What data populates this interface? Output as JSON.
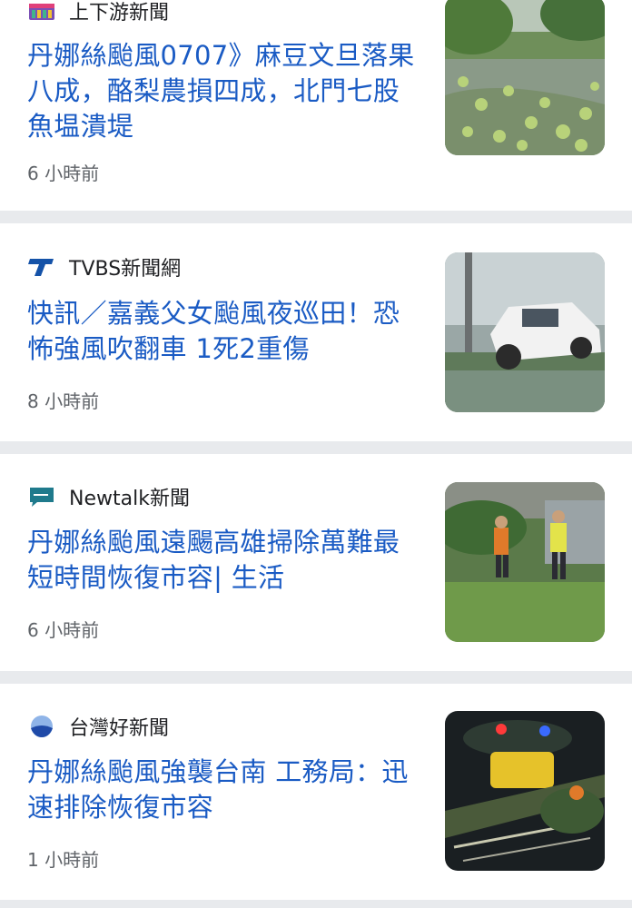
{
  "articles": [
    {
      "source": "上下游新聞",
      "source_icon": "newsmarket-logo-icon",
      "headline": "丹娜絲颱風0707》麻豆文旦落果八成，酪梨農損四成，北門七股魚塭潰堤",
      "time": "6 小時前",
      "thumbnail": "fallen-pomelos-orchard-photo"
    },
    {
      "source": "TVBS新聞網",
      "source_icon": "tvbs-logo-icon",
      "headline": "快訊／嘉義父女颱風夜巡田！恐怖強風吹翻車 1死2重傷",
      "time": "8 小時前",
      "thumbnail": "overturned-white-car-photo"
    },
    {
      "source": "Newtalk新聞",
      "source_icon": "newtalk-logo-icon",
      "headline": "丹娜絲颱風遠颺高雄掃除萬難最短時間恢復市容| 生活",
      "time": "6 小時前",
      "thumbnail": "workers-clearing-debris-photo"
    },
    {
      "source": "台灣好新聞",
      "source_icon": "taiwanhot-logo-icon",
      "headline": "丹娜絲颱風強襲台南 工務局：迅速排除恢復市容",
      "time": "1 小時前",
      "thumbnail": "fallen-tree-night-taxi-photo"
    }
  ],
  "colors": {
    "headline": "#1a5bc4",
    "separator": "#e8eaed",
    "source_text": "#202124",
    "time_text": "#5f6368"
  }
}
